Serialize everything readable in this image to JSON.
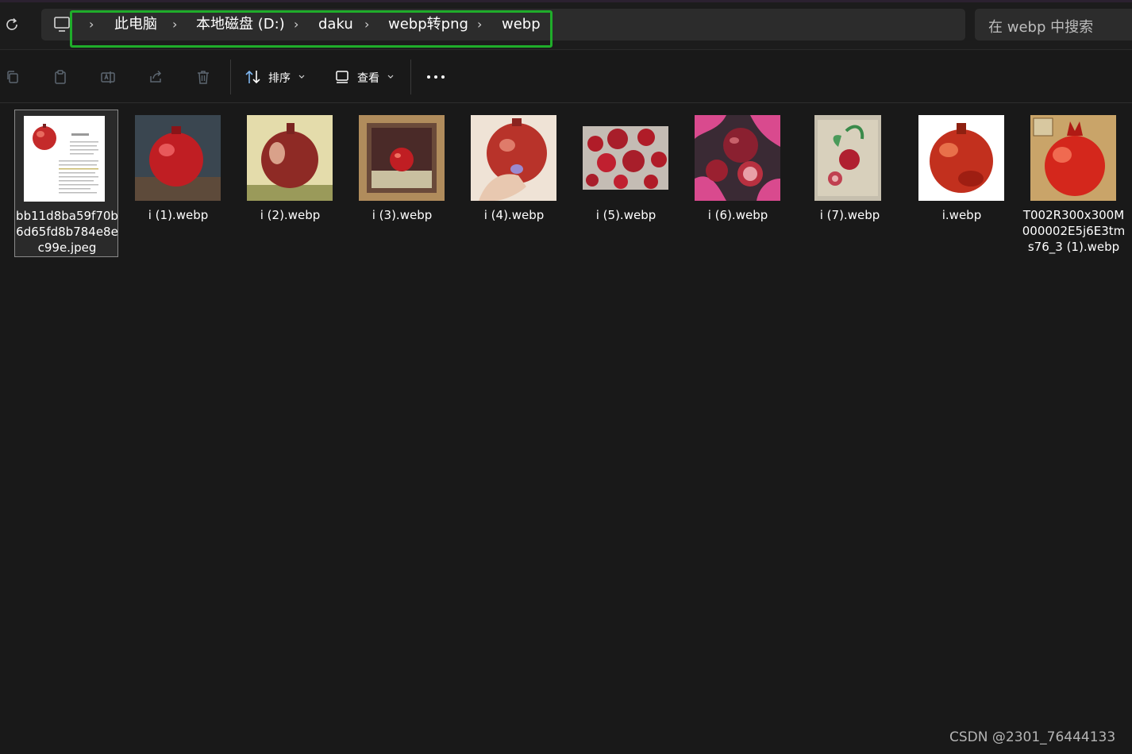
{
  "breadcrumb": [
    "此电脑",
    "本地磁盘 (D:)",
    "daku",
    "webp转png",
    "webp"
  ],
  "breadcrumb_separator": "›",
  "search": {
    "placeholder": "在 webp 中搜索"
  },
  "toolbar": {
    "sort_label": "排序",
    "view_label": "查看"
  },
  "files": [
    {
      "name": "bb11d8ba59f70b6d65fd8b784e8ec99e.jpeg",
      "selected": true
    },
    {
      "name": "i (1).webp"
    },
    {
      "name": "i (2).webp"
    },
    {
      "name": "i (3).webp"
    },
    {
      "name": "i (4).webp"
    },
    {
      "name": "i (5).webp"
    },
    {
      "name": "i (6).webp"
    },
    {
      "name": "i (7).webp"
    },
    {
      "name": "i.webp"
    },
    {
      "name": "T002R300x300M000002E5j6E3tms76_3 (1).webp"
    }
  ],
  "watermark": "CSDN @2301_76444133",
  "colors": {
    "highlight_box": "#1fad2a",
    "background": "#191919",
    "pomegranate": "#c42a2a"
  },
  "icons": [
    "refresh-icon",
    "computer-icon",
    "copy-icon",
    "paste-icon",
    "rename-icon",
    "share-icon",
    "delete-icon",
    "sort-icon",
    "view-icon",
    "more-icon",
    "chevron-down-icon"
  ]
}
